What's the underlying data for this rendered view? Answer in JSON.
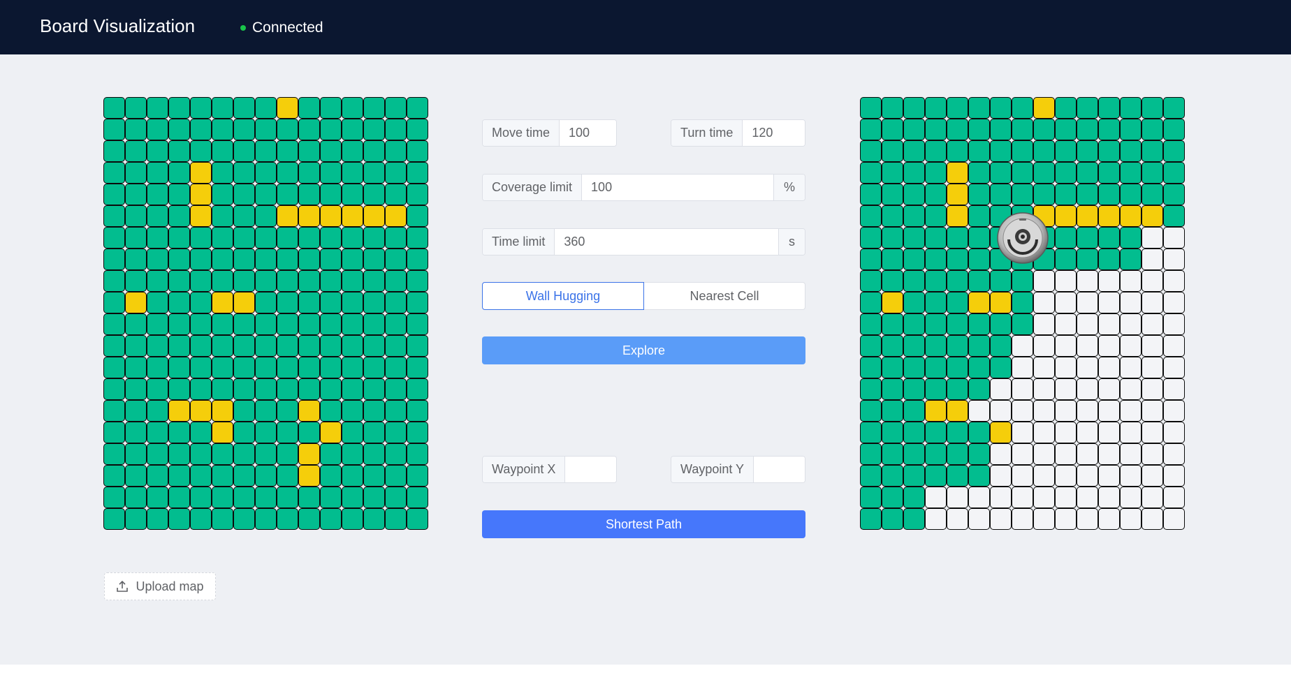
{
  "header": {
    "title": "Board Visualization",
    "status": "Connected",
    "status_color": "#19c44a"
  },
  "colors": {
    "header_bg": "#0b1730",
    "content_bg": "#eef0f4",
    "free_cell": "#02bd8f",
    "obstacle_cell": "#f5ce0b",
    "unexplored_cell": "#f3f4f7",
    "primary_light": "#5a9cf8",
    "primary": "#4677fb"
  },
  "legend_keys": {
    "o": "obstacle",
    "f": "free",
    "u": "unexplored"
  },
  "arena": {
    "rows": [
      "ffffffffoffffff",
      "fffffffffffffff",
      "fffffffffffffff",
      "ffffoffffffffff",
      "ffffoffffffffff",
      "ffffofffoooooof",
      "fffffffffffffff",
      "fffffffffffffff",
      "fffffffffffffff",
      "fofffoofffffffff",
      "fffffffffffffff",
      "fffffffffffffff",
      "fffffffffffffff",
      "fffffffffffffff",
      "fffooofffofffff",
      "fffffoffffofffff",
      "fffffffffofffff",
      "fffffffffofffff",
      "fffffffffffffff",
      "fffffffffffffff"
    ]
  },
  "explored": {
    "rows": [
      "ffffffffoffffff",
      "fffffffffffffff",
      "fffffffffffffff",
      "ffffoffffffffff",
      "ffffoffffffffff",
      "ffffofffoooooo",
      "fffffffffffffuuu",
      "fffffffffffffuuu",
      "ffffffffuuuuuuu",
      "fofffoofuuuuuuu",
      "ffffffffuuuuuuu",
      "fffffffuuuuuuuu",
      "fffffffuuuuuuuu",
      "ffffffuuuuuuuuu",
      "fffoouuuuuuuuuu",
      "ffffffouuuuuuuuu",
      "ffffffuuuuuuuuu",
      "ffffffuuuuuuuuu",
      "fffuuuuuuuuuuuu",
      "fffuuuuuuuuuuuu"
    ],
    "robot": {
      "row": 6,
      "col": 7,
      "icon": "robot-vacuum-icon"
    }
  },
  "controls": {
    "move_time": {
      "label": "Move time",
      "value": "100"
    },
    "turn_time": {
      "label": "Turn time",
      "value": "120"
    },
    "coverage_limit": {
      "label": "Coverage limit",
      "value": "100",
      "suffix": "%"
    },
    "time_limit": {
      "label": "Time limit",
      "value": "360",
      "suffix": "s"
    },
    "mode_options": [
      "Wall Hugging",
      "Nearest Cell"
    ],
    "mode_selected": "Wall Hugging",
    "explore_label": "Explore",
    "waypoint_x": {
      "label": "Waypoint X",
      "value": ""
    },
    "waypoint_y": {
      "label": "Waypoint Y",
      "value": ""
    },
    "shortest_path_label": "Shortest Path"
  },
  "upload": {
    "label": "Upload map",
    "icon": "upload-icon"
  }
}
